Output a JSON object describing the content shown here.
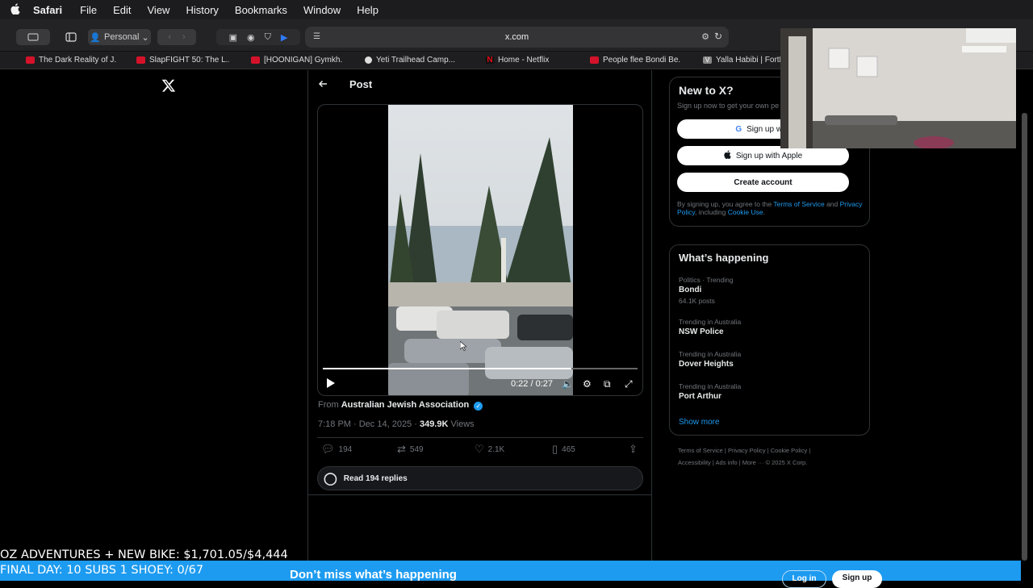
{
  "menubar": {
    "apple": "",
    "app": "Safari",
    "items": [
      "File",
      "Edit",
      "View",
      "History",
      "Bookmarks",
      "Window",
      "Help"
    ]
  },
  "toolbar": {
    "profile": "Personal",
    "url": "x.com"
  },
  "tabs": [
    {
      "label": "The Dark Reality of J..."
    },
    {
      "label": "SlapFIGHT 50: The L..."
    },
    {
      "label": "[HOONIGAN] Gymkh..."
    },
    {
      "label": "Yeti Trailhead Camp..."
    },
    {
      "label": "Home - Netflix",
      "fav": "N"
    },
    {
      "label": "People flee Bondi Be..."
    },
    {
      "label": "Yalla Habibi | FortNi",
      "fav": "V"
    }
  ],
  "post": {
    "back_icon": "←",
    "title": "Post",
    "video": {
      "time": "0:22 / 0:27",
      "progress_fraction": 0.79
    },
    "from_label": "From",
    "from_name": "Australian Jewish Association",
    "time": "7:18 PM · Dec 14, 2025 · ",
    "views_count": "349.9K",
    "views_label": " Views",
    "stats": {
      "replies": "194",
      "reposts": "549",
      "likes": "2.1K",
      "bookmarks": "465"
    },
    "read_replies": "Read 194 replies"
  },
  "sidebar": {
    "new_to_x": {
      "title": "New to X?",
      "subtitle": "Sign up now to get your own pe",
      "google": "Sign up with",
      "apple": "Sign up with Apple",
      "create": "Create account",
      "legal_1": "By signing up, you agree to the ",
      "terms": "Terms of Service",
      "legal_2": " and ",
      "privacy": "Privacy Policy",
      "legal_3": ", including ",
      "cookie": "Cookie Use",
      "legal_4": "."
    },
    "happening": {
      "title": "What’s happening",
      "trends": [
        {
          "category": "Politics · Trending",
          "name": "Bondi",
          "count": "64.1K posts"
        },
        {
          "category": "Trending in Australia",
          "name": "NSW Police",
          "count": ""
        },
        {
          "category": "Trending in Australia",
          "name": "Dover Heights",
          "count": ""
        },
        {
          "category": "Trending in Australia",
          "name": "Port Arthur",
          "count": ""
        }
      ],
      "show_more": "Show more"
    },
    "footer": {
      "line1": "Terms of Service  |   Privacy Policy  |   Cookie Policy  |",
      "line2": "Accessibility  |   Ads info  |   More ···   © 2025 X Corp."
    }
  },
  "overlay": {
    "line1": "OZ ADVENTURES + NEW BIKE: $1,701.05/$4,444",
    "line2": "FINAL DAY: 10 SUBS 1 SHOEY: 0/67"
  },
  "banner": {
    "text": "Don’t miss what’s happening",
    "login": "Log in",
    "signup": "Sign up"
  }
}
